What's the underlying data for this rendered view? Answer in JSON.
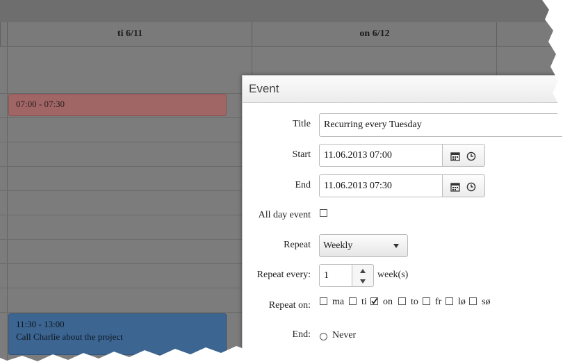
{
  "calendar": {
    "columns": [
      {
        "header": "ti 6/11"
      },
      {
        "header": "on 6/12"
      }
    ],
    "events": [
      {
        "time": "07:00 - 07:30",
        "title": ""
      },
      {
        "time": "11:30 - 13:00",
        "title": "Call Charlie about the project"
      }
    ],
    "colors": {
      "event_red": "#a06665",
      "event_blue": "#3c6591"
    }
  },
  "dialog": {
    "title": "Event",
    "fields": {
      "title_label": "Title",
      "title_value": "Recurring every Tuesday",
      "start_label": "Start",
      "start_value": "11.06.2013 07:00",
      "end_label": "End",
      "end_value": "11.06.2013 07:30",
      "allday_label": "All day event",
      "allday_checked": false,
      "repeat_label": "Repeat",
      "repeat_value": "Weekly",
      "repeat_every_label": "Repeat every:",
      "repeat_every_value": "1",
      "repeat_every_unit": "week(s)",
      "repeat_on_label": "Repeat on:",
      "end_label2": "End:",
      "end_option": "Never"
    },
    "weekdays": [
      {
        "label": "ma",
        "checked": false
      },
      {
        "label": "ti",
        "checked": true
      },
      {
        "label": "on",
        "checked": false
      },
      {
        "label": "to",
        "checked": false
      },
      {
        "label": "fr",
        "checked": false
      },
      {
        "label": "lø",
        "checked": false
      },
      {
        "label": "sø",
        "checked": false
      }
    ],
    "icons": {
      "calendar": "calendar-icon",
      "clock": "clock-icon",
      "dropdown": "caret-down-icon"
    }
  }
}
